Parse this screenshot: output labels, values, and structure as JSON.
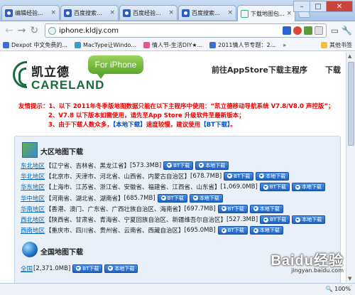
{
  "browser": {
    "tabs": [
      {
        "label": "编辑经验...",
        "icon": "paw-icon",
        "active": false
      },
      {
        "label": "百度搜索...",
        "icon": "paw-icon",
        "active": false
      },
      {
        "label": "百度经验...",
        "icon": "paw-icon",
        "active": false
      },
      {
        "label": "百度搜索...",
        "icon": "paw-icon",
        "active": false
      },
      {
        "label": "下载地图包...",
        "icon": "careland-icon",
        "active": true
      }
    ],
    "window_controls": {
      "minimize": "–",
      "maximize": "□",
      "close": "✕"
    },
    "nav": {
      "back": "←",
      "forward": "→",
      "reload": "↻"
    },
    "url": "iphone.kldjy.com",
    "bookmarks": [
      {
        "label": "Dexpot 中文免费的...",
        "color": "#3a6fd0"
      },
      {
        "label": "MacType让Windo...",
        "color": "#2aa0d8"
      },
      {
        "label": "情人节-生活DIY★...",
        "color": "#e05a8a"
      },
      {
        "label": "2011情人节专题：2...",
        "color": "#3a6fd0"
      }
    ],
    "bookmarks_overflow": "»",
    "other_bookmarks": "其他书签",
    "zoom": "100%"
  },
  "header": {
    "brand_cn": "凯立德",
    "brand_en": "CARELAND",
    "badge": "For iPhone",
    "nav_appstore": "前往AppStore下载主程序",
    "nav_download": "下载"
  },
  "notice": {
    "line1": "友情提示：1、以下 2011年冬季版地图数据只能在以下主程序中使用：“凯立德移动导航系统 V7.8/V8.0 声控版”；",
    "line2": "2、V7.8 以下版本如需使用，请先至App Store 升级软件至最新版本；",
    "line3_a": "3、由于下载人数众多，",
    "line3_b": "【本地下载】",
    "line3_c": "速度较慢，建议使用",
    "line3_d": "【BT下载】",
    "line3_e": "。"
  },
  "regional": {
    "title": "大区地图下载",
    "rows": [
      {
        "name": "东北地区",
        "provinces": "【辽宁省、吉林省、黑龙江省】",
        "size": "[573.3MB]"
      },
      {
        "name": "华北地区",
        "provinces": "【北京市、天津市、河北省、山西省、内蒙古自治区】",
        "size": "[678.7MB]"
      },
      {
        "name": "华东地区",
        "provinces": "【上海市、江苏省、浙江省、安徽省、福建省、江西省、山东省】",
        "size": "[1,069.0MB]"
      },
      {
        "name": "华中地区",
        "provinces": "【河南省、湖北省、湖南省】",
        "size": "[685.7MB]"
      },
      {
        "name": "华南地区",
        "provinces": "【香港、澳门、广东省、广西壮族自治区、海南省】",
        "size": "[697.7MB]"
      },
      {
        "name": "西北地区",
        "provinces": "【陕西省、甘肃省、青海省、宁夏回族自治区、新疆维吾尔自治区】",
        "size": "[527.3MB]"
      },
      {
        "name": "西南地区",
        "provinces": "【重庆市、四川省、贵州省、云南省、西藏自治区】",
        "size": "[695.0MB]"
      }
    ],
    "bt_label": "BT下载",
    "local_label": "本地下载"
  },
  "national": {
    "title": "全国地图下载",
    "name": "全国",
    "size": "[2,371.0MB]"
  },
  "watermark": {
    "logo": "Baidu经验",
    "url": "jingyan.baidu.com"
  }
}
